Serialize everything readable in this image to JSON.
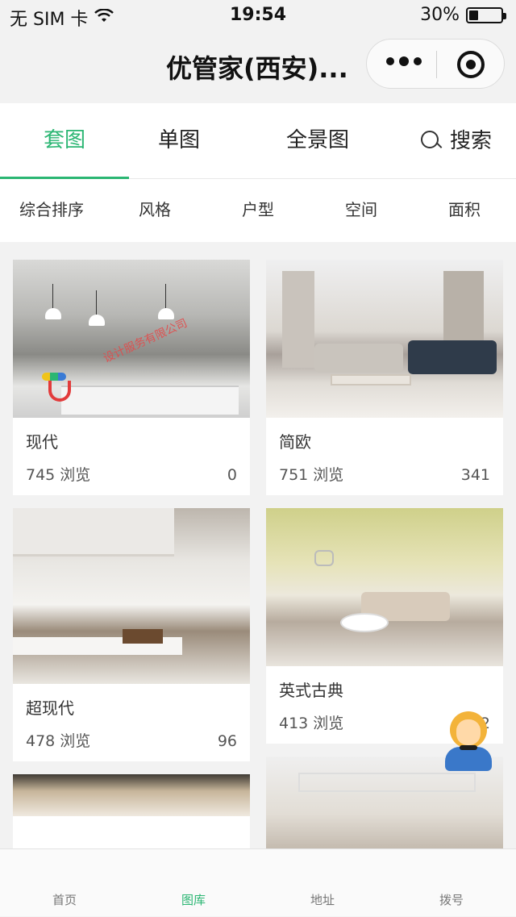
{
  "status_bar": {
    "carrier": "无 SIM 卡",
    "time": "19:54",
    "battery": "30%",
    "battery_level": 0.3,
    "wifi_icon": "wifi-icon",
    "battery_icon": "battery-icon"
  },
  "nav": {
    "title": "优管家(西安)...",
    "more_icon": "more-icon",
    "close_icon": "target-icon"
  },
  "tabs": [
    {
      "label": "套图",
      "active": true
    },
    {
      "label": "单图",
      "active": false
    },
    {
      "label": "全景图",
      "active": false
    },
    {
      "label": "搜索",
      "active": false,
      "icon": "search-icon"
    }
  ],
  "filters": [
    "综合排序",
    "风格",
    "户型",
    "空间",
    "面积"
  ],
  "cards": [
    {
      "title": "现代",
      "views": "745 浏览",
      "count": "0",
      "image_desc": "modern kitchen with pendant lamps",
      "watermark": "设计服务有限公司"
    },
    {
      "title": "简欧",
      "views": "751 浏览",
      "count": "341",
      "image_desc": "living room with blue sofa"
    },
    {
      "title": "超现代",
      "views": "478 浏览",
      "count": "96",
      "image_desc": "minimalist white interior"
    },
    {
      "title": "英式古典",
      "views": "413 浏览",
      "count": "2",
      "image_desc": "classic living room with chandelier"
    },
    {
      "title": "",
      "views": "",
      "count": "",
      "image_desc": "ceiling lights partial"
    },
    {
      "title": "",
      "views": "",
      "count": "",
      "image_desc": "coffered ceiling partial"
    }
  ],
  "service_icon": "customer-service-icon",
  "bottom_bar": [
    {
      "label": "首页",
      "active": false
    },
    {
      "label": "图库",
      "active": true
    },
    {
      "label": "地址",
      "active": false
    },
    {
      "label": "拨号",
      "active": false
    }
  ],
  "colors": {
    "accent": "#2bb673",
    "text": "#333333",
    "background": "#f3f3f3"
  }
}
